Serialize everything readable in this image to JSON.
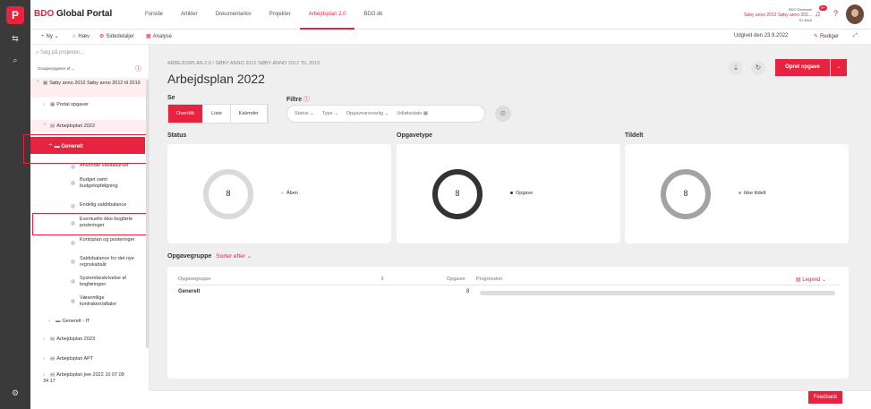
{
  "app": {
    "brand_bdo": "BDO",
    "brand_rest": " Global Portal"
  },
  "nav": {
    "items": [
      {
        "label": "Forside",
        "active": false
      },
      {
        "label": "Artikler",
        "active": false
      },
      {
        "label": "Dokumentarkiv",
        "active": false
      },
      {
        "label": "Projekter",
        "active": false
      },
      {
        "label": "Arbejdsplan 2.0",
        "active": true
      },
      {
        "label": "BDO.dk",
        "active": false
      }
    ]
  },
  "topbar": {
    "org": "BDO Denmark",
    "context": "Søby anno 2012 Søby anno 201...",
    "context_sub": "ID 4643",
    "notification_count": "9+"
  },
  "cmdbar": {
    "new_label": "Ny",
    "follow_label": "Hæv",
    "details_label": "Sidedetaljer",
    "analysis_label": "Analyse",
    "published": "Udgivet den 23.9.2022",
    "edit_label": "Rediger"
  },
  "sidebar": {
    "search_placeholder": "Søg på projekter...",
    "group_label": "Gruppeopgaver af",
    "tree": {
      "project": "Søby anno 2012 Søby anno 2012 til 2019",
      "portal": "Portal opgaver",
      "plan2022": "Arbejdsplan 2022",
      "generelt": "Generelt",
      "leaves": [
        "Anvendte valutakurser",
        "Budget samt budgetopfølgning",
        "Endelig saldobalance",
        "Eventuelle ikke-bogførte posteringer",
        "Kontoplan og posteringer",
        "Saldobalance for det nye regnskabsår",
        "Systembeskrivelse af bogføringen",
        "Væsentlige kontrakter/aftaler"
      ],
      "generelt_it": "Generelt - IT",
      "plan2023": "Arbejdsplan 2023",
      "plan_apt": "Arbejdsplan APT",
      "plan_jwe": "Arbejdsplan jwe 2022 10 07 09 34 17"
    }
  },
  "main": {
    "breadcrumb": "ARBEJDSPLAN 2.0  /  SØBY ANNO 2012 SØBY ANNO 2012 TIL 2019",
    "title": "Arbejdsplan 2022",
    "create_label": "Opret opgave",
    "view_heading": "Se",
    "filter_heading": "Filtre",
    "views": [
      {
        "label": "Overblik",
        "active": true
      },
      {
        "label": "Liste",
        "active": false
      },
      {
        "label": "Kalender",
        "active": false
      }
    ],
    "filters": [
      "Status",
      "Type",
      "Opgaveansvarlig",
      "Udløbsdato"
    ],
    "cards": {
      "status": {
        "title": "Status",
        "value": "8",
        "legend": "Åben",
        "ring_color": "#d9d9de"
      },
      "type": {
        "title": "Opgavetype",
        "value": "8",
        "legend": "Opgave",
        "ring_color": "#333333"
      },
      "assigned": {
        "title": "Tildelt",
        "value": "8",
        "legend": "Ikke tildelt",
        "ring_color": "#a3a3a3"
      }
    },
    "group_heading": "Opgavegruppe",
    "sort_label": "Sorter efter",
    "table": {
      "col_group": "Opgavegruppe",
      "col_tasks": "Opgaver",
      "col_progress": "Progression",
      "legend_label": "Legend",
      "rows": [
        {
          "group": "Generelt",
          "tasks": "8"
        }
      ]
    }
  },
  "footer": {
    "feedback_label": "Feedback"
  },
  "colors": {
    "accent": "#e8233f",
    "rail": "#3a3a3a",
    "background": "#efefef"
  }
}
